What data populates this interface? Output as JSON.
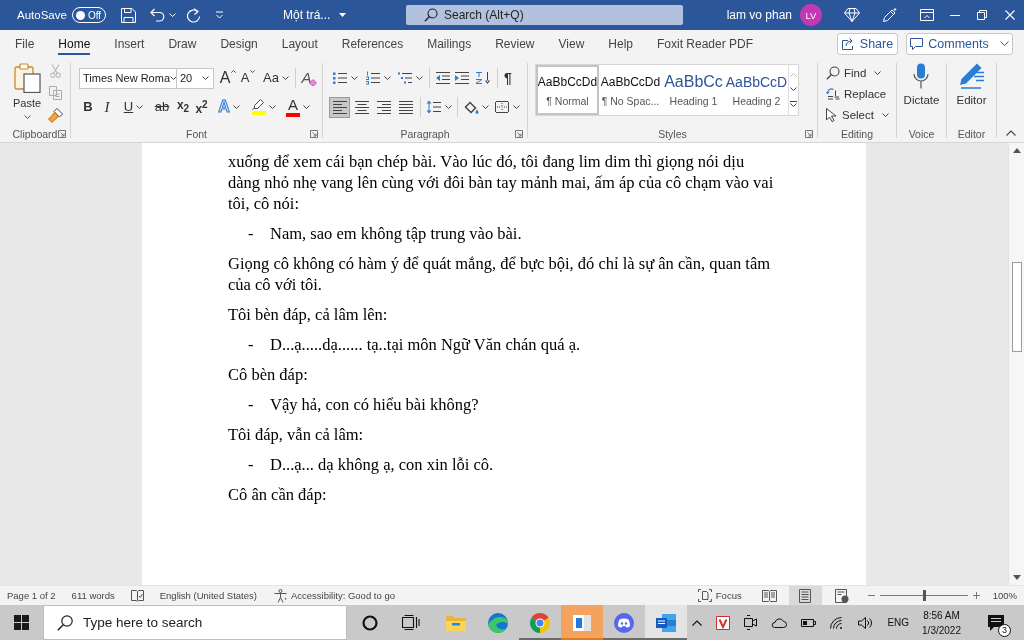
{
  "title_bar": {
    "autosave": {
      "label": "AutoSave",
      "on": false,
      "state_text": "Off"
    },
    "document_title": "Một trá...",
    "search": {
      "placeholder": "Search (Alt+Q)"
    },
    "user": {
      "name": "lam vo phan",
      "initials": "LV"
    }
  },
  "tabs": [
    {
      "label": "File",
      "selected": false
    },
    {
      "label": "Home",
      "selected": true
    },
    {
      "label": "Insert",
      "selected": false
    },
    {
      "label": "Draw",
      "selected": false
    },
    {
      "label": "Design",
      "selected": false
    },
    {
      "label": "Layout",
      "selected": false
    },
    {
      "label": "References",
      "selected": false
    },
    {
      "label": "Mailings",
      "selected": false
    },
    {
      "label": "Review",
      "selected": false
    },
    {
      "label": "View",
      "selected": false
    },
    {
      "label": "Help",
      "selected": false
    },
    {
      "label": "Foxit Reader PDF",
      "selected": false
    }
  ],
  "tab_actions": {
    "share": "Share",
    "comments": "Comments"
  },
  "ribbon": {
    "clipboard": {
      "label": "Clipboard",
      "paste": "Paste",
      "tools": [
        {
          "kind": "cut",
          "disabled": true
        },
        {
          "kind": "copy",
          "disabled": true
        },
        {
          "kind": "painter",
          "disabled": false
        }
      ]
    },
    "font": {
      "label": "Font",
      "font_name": "Times New Roma",
      "font_size": "20",
      "size_tools": [
        {
          "kind": "grow",
          "label": "A",
          "dropdown": false
        },
        {
          "kind": "shrink",
          "label": "A",
          "dropdown": false
        },
        {
          "kind": "case",
          "label": "Aa",
          "dropdown": true
        },
        {
          "kind": "clear",
          "label": "A",
          "dropdown": false
        }
      ],
      "format_tools": [
        {
          "kind": "bold",
          "label": "B",
          "dropdown": false
        },
        {
          "kind": "italic",
          "label": "I",
          "dropdown": false
        },
        {
          "kind": "underline",
          "label": "U",
          "dropdown": true
        },
        {
          "kind": "strike",
          "label": "ab",
          "dropdown": false
        },
        {
          "kind": "subscript",
          "label": "x$_{2}$",
          "dropdown": false
        },
        {
          "kind": "superscript",
          "label": "x$^{2}$",
          "dropdown": false
        },
        {
          "kind": "effects",
          "label": "A",
          "dropdown": true
        },
        {
          "kind": "highlight",
          "color": "#ffff00",
          "dropdown": true
        },
        {
          "kind": "font_color",
          "label": "A",
          "color": "#ff0000",
          "dropdown": true
        }
      ]
    },
    "paragraph": {
      "label": "Paragraph",
      "list_tools": [
        {
          "kind": "bullets",
          "dropdown": true
        },
        {
          "kind": "numbering",
          "dropdown": true
        },
        {
          "kind": "multilevel",
          "dropdown": true
        },
        {
          "kind": "outdent",
          "dropdown": false
        },
        {
          "kind": "indent",
          "dropdown": false
        },
        {
          "kind": "sort",
          "dropdown": false
        },
        {
          "kind": "marks",
          "label": "¶",
          "dropdown": false
        }
      ],
      "alignment": [
        {
          "kind": "left",
          "selected": true
        },
        {
          "kind": "center",
          "selected": false
        },
        {
          "kind": "right",
          "selected": false
        },
        {
          "kind": "justify",
          "selected": false
        }
      ],
      "spacing_tools": [
        {
          "kind": "line_spacing",
          "dropdown": true
        },
        {
          "kind": "shading",
          "dropdown": true
        },
        {
          "kind": "borders",
          "dropdown": true
        }
      ]
    },
    "styles": {
      "label": "Styles",
      "items": [
        {
          "kind": "body",
          "preview": "AaBbCcDd",
          "name": "¶ Normal",
          "selected": true
        },
        {
          "kind": "body",
          "preview": "AaBbCcDd",
          "name": "¶ No Spac...",
          "selected": false
        },
        {
          "kind": "heading1",
          "preview": "AaBbCc",
          "name": "Heading 1",
          "selected": false
        },
        {
          "kind": "heading2",
          "preview": "AaBbCcD",
          "name": "Heading 2",
          "selected": false
        }
      ]
    },
    "editing": {
      "label": "Editing",
      "items": [
        {
          "kind": "find",
          "label": "Find",
          "dropdown": true
        },
        {
          "kind": "replace",
          "label": "Replace",
          "dropdown": false
        },
        {
          "kind": "select",
          "label": "Select",
          "dropdown": true
        }
      ]
    },
    "voice": {
      "label": "Voice",
      "button": "Dictate"
    },
    "editor": {
      "label": "Editor",
      "button": "Editor"
    }
  },
  "document": {
    "paragraphs": [
      {
        "kind": "text",
        "text": "xuống để xem cái bạn chép bài. Vào lúc đó, tôi đang lim dim thì giọng nói dịu dàng nhỏ nhẹ vang lên cùng với đôi bàn tay mảnh mai, ấm áp của cô chạm vào vai tôi, cô nói:"
      },
      {
        "kind": "dialogue",
        "marker": "-",
        "text": "Nam, sao em không tập trung vào bài."
      },
      {
        "kind": "text",
        "text": "Giọng cô không có hàm ý để quát mắng, để bực bội, đó chỉ là sự ân cần, quan tâm của cô với tôi."
      },
      {
        "kind": "text",
        "text": "Tôi bèn đáp, cả lâm lên:"
      },
      {
        "kind": "dialogue",
        "marker": "-",
        "text": "D...ạ.....dạ...... tạ..tại môn Ngữ Văn chán quá ạ."
      },
      {
        "kind": "text",
        "text": "Cô bèn đáp:"
      },
      {
        "kind": "dialogue",
        "marker": "-",
        "text": "Vậy hả, con có hiểu bài không?"
      },
      {
        "kind": "text",
        "text": "Tôi đáp, vẫn cả lâm:"
      },
      {
        "kind": "dialogue",
        "marker": "-",
        "text": "D...ạ... dạ không ạ, con xin lỗi cô."
      },
      {
        "kind": "text",
        "text": "Cô ân cần đáp:"
      }
    ]
  },
  "status_bar": {
    "page": "Page 1 of 2",
    "words": "611 words",
    "language": "English (United States)",
    "accessibility": "Accessibility: Good to go",
    "focus": "Focus",
    "views": [
      {
        "kind": "read",
        "selected": false
      },
      {
        "kind": "print",
        "selected": true
      },
      {
        "kind": "web",
        "selected": false
      }
    ],
    "zoom": {
      "level": 0.5,
      "reading": "100%"
    }
  },
  "taskbar": {
    "search": {
      "placeholder": "Type here to search"
    },
    "apps": [
      {
        "kind": "explorer",
        "running": false,
        "selected": false,
        "flashing": false
      },
      {
        "kind": "edge",
        "running": false,
        "selected": false,
        "flashing": false
      },
      {
        "kind": "chrome",
        "running": true,
        "selected": false,
        "flashing": false
      },
      {
        "kind": "tile",
        "running": true,
        "selected": false,
        "flashing": true
      },
      {
        "kind": "discord",
        "running": true,
        "selected": false,
        "flashing": false
      },
      {
        "kind": "word",
        "running": true,
        "selected": true,
        "flashing": false
      }
    ],
    "tray": {
      "language": "ENG",
      "time": "8:56 AM",
      "date": "1/3/2022",
      "notifications": "3"
    }
  }
}
